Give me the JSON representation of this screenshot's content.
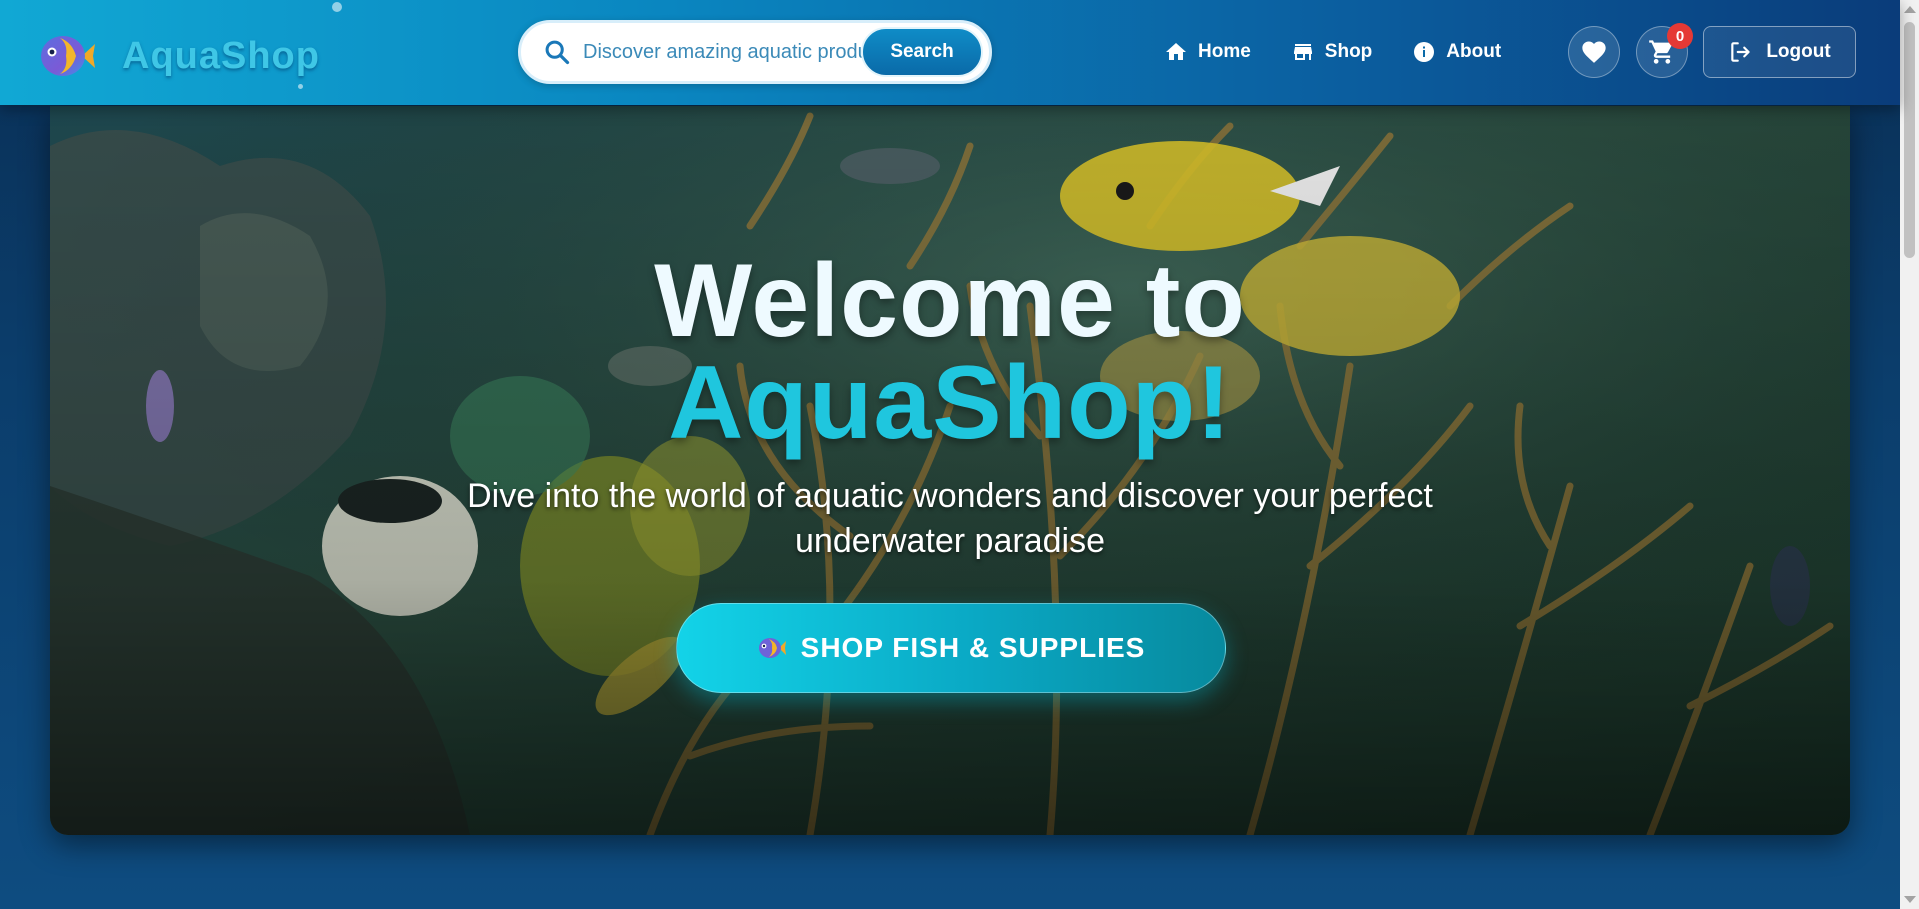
{
  "brand": {
    "name": "AquaShop",
    "logo_icon": "fish-logo-icon"
  },
  "search": {
    "placeholder": "Discover amazing aquatic products...",
    "button_label": "Search",
    "icon": "search-icon"
  },
  "nav": {
    "items": [
      {
        "label": "Home",
        "icon": "home-icon"
      },
      {
        "label": "Shop",
        "icon": "store-icon"
      },
      {
        "label": "About",
        "icon": "info-icon"
      }
    ]
  },
  "actions": {
    "wishlist_icon": "heart-icon",
    "cart_icon": "cart-icon",
    "cart_count": "0",
    "logout_label": "Logout",
    "logout_icon": "logout-icon"
  },
  "hero": {
    "title_line1": "Welcome to",
    "title_line2": "AquaShop!",
    "subtitle": "Dive into the world of aquatic wonders and discover your perfect underwater paradise",
    "cta_label": "SHOP FISH & SUPPLIES",
    "cta_icon": "fish-icon"
  },
  "colors": {
    "navbar_start": "#11a8d4",
    "navbar_end": "#0a3c7a",
    "accent_cyan": "#1fc6de",
    "badge_red": "#e53935"
  }
}
